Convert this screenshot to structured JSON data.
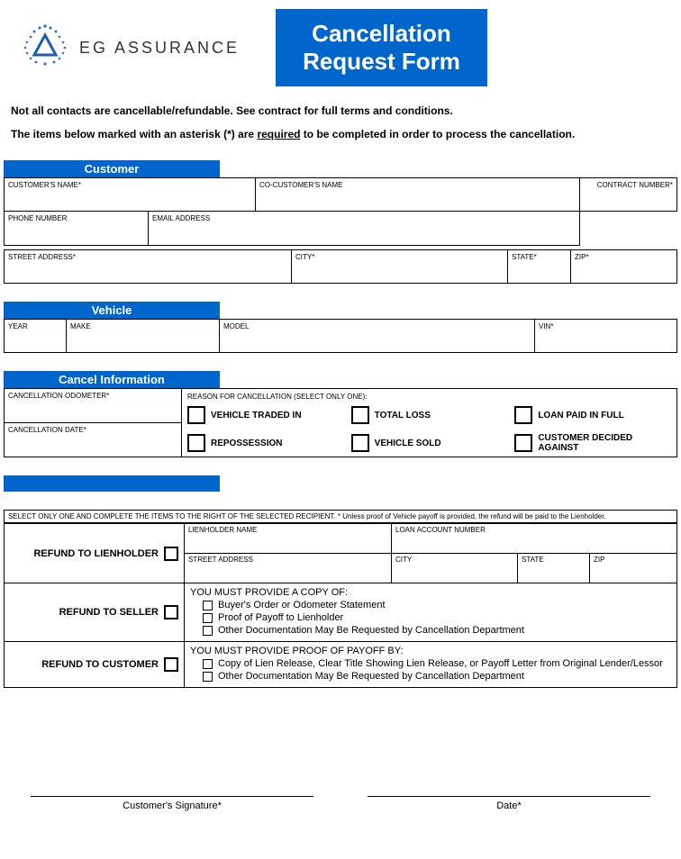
{
  "logo": {
    "company_eg": "EG",
    "company_assurance": "ASSURANCE"
  },
  "title": {
    "line1": "Cancellation",
    "line2": "Request Form"
  },
  "intro": {
    "p1": "Not all contacts are cancellable/refundable. See contract for full terms and conditions.",
    "p2_a": "The items below marked with an asterisk (*) are ",
    "p2_u": "required",
    "p2_b": " to be completed in order to process the cancellation."
  },
  "sections": {
    "customer": "Customer",
    "vehicle": "Vehicle",
    "cancel": "Cancel Information"
  },
  "customer": {
    "name": "CUSTOMER'S NAME*",
    "co_name": "CO-CUSTOMER'S NAME",
    "contract": "CONTRACT NUMBER*",
    "phone": "PHONE NUMBER",
    "email": "EMAIL ADDRESS",
    "street": "STREET ADDRESS*",
    "city": "CITY*",
    "state": "STATE*",
    "zip": "ZIP*"
  },
  "vehicle": {
    "year": "YEAR",
    "make": "MAKE",
    "model": "MODEL",
    "vin": "VIN*"
  },
  "cancel": {
    "odometer": "CANCELLATION ODOMETER*",
    "date": "CANCELLATION DATE*",
    "reason_label": "REASON FOR CANCELLATION (SELECT ONLY ONE):",
    "reasons": {
      "r1": "VEHICLE TRADED IN",
      "r2": "TOTAL LOSS",
      "r3": "LOAN PAID IN FULL",
      "r4": "REPOSSESSION",
      "r5": "VEHICLE SOLD",
      "r6": "CUSTOMER DECIDED AGAINST"
    }
  },
  "refund": {
    "instruction": "SELECT ONLY ONE AND COMPLETE THE ITEMS TO THE RIGHT OF THE SELECTED RECIPIENT. * Unless proof of Vehicle payoff is provided, the refund will be paid to the Lienholder.",
    "to_lien": "REFUND TO LIENHOLDER",
    "to_seller": "REFUND TO SELLER",
    "to_customer": "REFUND TO CUSTOMER",
    "lien_name": "LIENHOLDER NAME",
    "loan_acct": "LOAN ACCOUNT NUMBER",
    "street": "STREET ADDRESS",
    "city": "CITY",
    "state": "STATE",
    "zip": "ZIP",
    "seller_hd": "YOU MUST PROVIDE A COPY OF:",
    "seller_i1": "Buyer's Order or Odometer Statement",
    "seller_i2": "Proof of Payoff to Lienholder",
    "seller_i3": "Other Documentation May Be Requested by Cancellation Department",
    "cust_hd": "YOU MUST PROVIDE PROOF OF PAYOFF BY:",
    "cust_i1": "Copy of Lien Release, Clear Title Showing Lien Release, or Payoff Letter from Original Lender/Lessor",
    "cust_i2": "Other Documentation May Be Requested by Cancellation Department"
  },
  "signature": {
    "customer": "Customer's Signature*",
    "date": "Date*"
  }
}
